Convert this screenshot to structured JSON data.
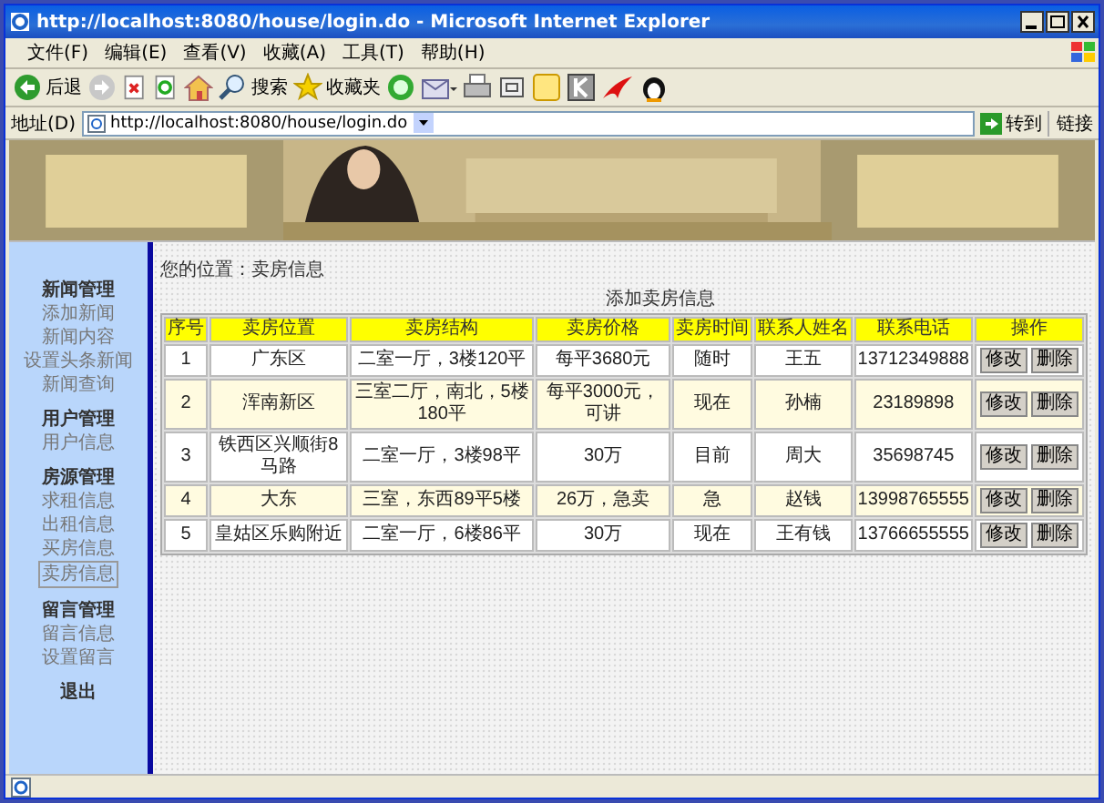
{
  "window": {
    "title": "http://localhost:8080/house/login.do - Microsoft Internet Explorer"
  },
  "menu": [
    "文件(F)",
    "编辑(E)",
    "查看(V)",
    "收藏(A)",
    "工具(T)",
    "帮助(H)"
  ],
  "toolbar": [
    {
      "kind": "back",
      "label": "后退"
    },
    {
      "kind": "forward"
    },
    {
      "kind": "stop"
    },
    {
      "kind": "refresh"
    },
    {
      "kind": "home"
    },
    {
      "kind": "search",
      "label": "搜索"
    },
    {
      "kind": "favorites",
      "label": "收藏夹"
    },
    {
      "kind": "media"
    },
    {
      "kind": "mail"
    },
    {
      "kind": "print"
    },
    {
      "kind": "window"
    },
    {
      "kind": "note"
    },
    {
      "kind": "k"
    },
    {
      "kind": "bird"
    },
    {
      "kind": "penguin"
    }
  ],
  "address": {
    "label": "地址(D)",
    "value": "http://localhost:8080/house/login.do",
    "go": "转到",
    "links": "链接"
  },
  "sidebar": [
    {
      "title": "新闻管理",
      "items": [
        {
          "label": "添加新闻",
          "selected": false
        },
        {
          "label": "新闻内容",
          "selected": false
        },
        {
          "label": "设置头条新闻",
          "selected": false
        },
        {
          "label": "新闻查询",
          "selected": false
        }
      ]
    },
    {
      "title": "用户管理",
      "items": [
        {
          "label": "用户信息",
          "selected": false
        }
      ]
    },
    {
      "title": "房源管理",
      "items": [
        {
          "label": "求租信息",
          "selected": false
        },
        {
          "label": "出租信息",
          "selected": false
        },
        {
          "label": "买房信息",
          "selected": false
        },
        {
          "label": "卖房信息",
          "selected": true
        }
      ]
    },
    {
      "title": "留言管理",
      "items": [
        {
          "label": "留言信息",
          "selected": false
        },
        {
          "label": "设置留言",
          "selected": false
        }
      ]
    },
    {
      "title": "退出"
    }
  ],
  "breadcrumb": "您的位置：卖房信息",
  "add_link": "添加卖房信息",
  "table": {
    "columns": [
      "序号",
      "卖房位置",
      "卖房结构",
      "卖房价格",
      "卖房时间",
      "联系人姓名",
      "联系电话",
      "操作"
    ],
    "rows": [
      {
        "cells": [
          "1",
          "广东区",
          "二室一厅，3楼120平",
          "每平3680元",
          "随时",
          "王五",
          "13712349888"
        ],
        "actions": [
          "修改",
          "删除"
        ]
      },
      {
        "cells": [
          "2",
          "浑南新区",
          "三室二厅，南北，5楼180平",
          "每平3000元，可讲",
          "现在",
          "孙楠",
          "23189898"
        ],
        "actions": [
          "修改",
          "删除"
        ]
      },
      {
        "cells": [
          "3",
          "铁西区兴顺街8马路",
          "二室一厅，3楼98平",
          "30万",
          "目前",
          "周大",
          "35698745"
        ],
        "actions": [
          "修改",
          "删除"
        ]
      },
      {
        "cells": [
          "4",
          "大东",
          "三室，东西89平5楼",
          "26万，急卖",
          "急",
          "赵钱",
          "13998765555"
        ],
        "actions": [
          "修改",
          "删除"
        ]
      },
      {
        "cells": [
          "5",
          "皇姑区乐购附近",
          "二室一厅，6楼86平",
          "30万",
          "现在",
          "王有钱",
          "13766655555"
        ],
        "actions": [
          "修改",
          "删除"
        ]
      }
    ]
  }
}
